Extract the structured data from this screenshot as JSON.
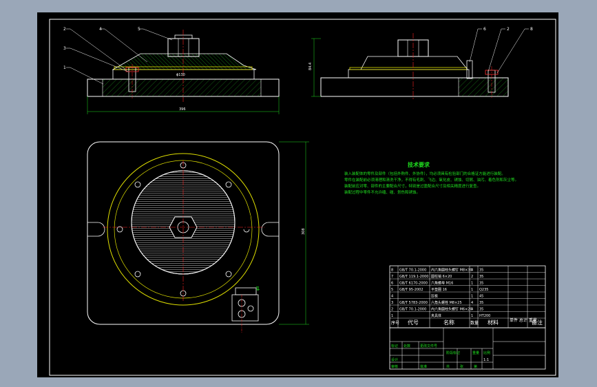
{
  "colors": {
    "background": "#9aa7b8",
    "sheet": "#000000",
    "outline": "#ffffff",
    "centerline": "#ff2020",
    "hatch": "#20c020",
    "dimension": "#20e020",
    "flange": "#e0e000",
    "notes": "#20e020"
  },
  "balloons": {
    "front": [
      "2",
      "4",
      "5",
      "3",
      "1"
    ],
    "side": [
      "6",
      "2",
      "8"
    ]
  },
  "dimensions": {
    "front_width": "396",
    "front_inner": "ϕ130",
    "side_height": "84.4",
    "plan_height": "308"
  },
  "tech_notes": {
    "title": "技术要求",
    "lines": [
      "装入装配体的零件及部件（包括外购件、外协件），均必须具有检验部门的合格证方能进行装配。",
      "零件在装配前必须清理和清洗干净，不得有毛刺、飞边、氧化皮、锈蚀、切屑、油污、着色剂和灰尘等。",
      "装配前应对零、部件的主要配合尺寸，特别是过盈配合尺寸及相关精度进行复查。",
      "装配过程中零件不允许磕、碰、划伤和锈蚀。"
    ]
  },
  "parts_table": {
    "rows": [
      [
        "8",
        "GB/T 70.1-2000",
        "内六角圆柱头螺钉 M8×30",
        "4",
        "35",
        "",
        ""
      ],
      [
        "7",
        "GB/T 119.1-2000",
        "圆柱销 6×20",
        "2",
        "35",
        "",
        ""
      ],
      [
        "6",
        "GB/T 6170-2000",
        "六角螺母 M16",
        "1",
        "35",
        "",
        ""
      ],
      [
        "5",
        "GB/T 95-2002",
        "平垫圈 16",
        "1",
        "Q235",
        "",
        ""
      ],
      [
        "4",
        "",
        "压板",
        "1",
        "45",
        "",
        ""
      ],
      [
        "3",
        "GB/T 5783-2000",
        "六角头螺栓 M8×25",
        "4",
        "35",
        "",
        ""
      ],
      [
        "2",
        "GB/T 70.1-2000",
        "内六角圆柱头螺钉 M6×20",
        "4",
        "35",
        "",
        ""
      ],
      [
        "1",
        "",
        "夹具体",
        "1",
        "HT200",
        "",
        ""
      ]
    ],
    "header": [
      "序号",
      "代号",
      "名称",
      "数量",
      "材料",
      "单件 总计 重量",
      "备注"
    ]
  },
  "title_block": {
    "labels": [
      "标记",
      "处数",
      "分区",
      "更改文件号",
      "签名",
      "年月日",
      "设计",
      "标准化",
      "审核",
      "工艺",
      "批准",
      "阶段标记",
      "重量",
      "比例",
      "共",
      "张",
      "第",
      "张"
    ],
    "scale": "1:1"
  }
}
